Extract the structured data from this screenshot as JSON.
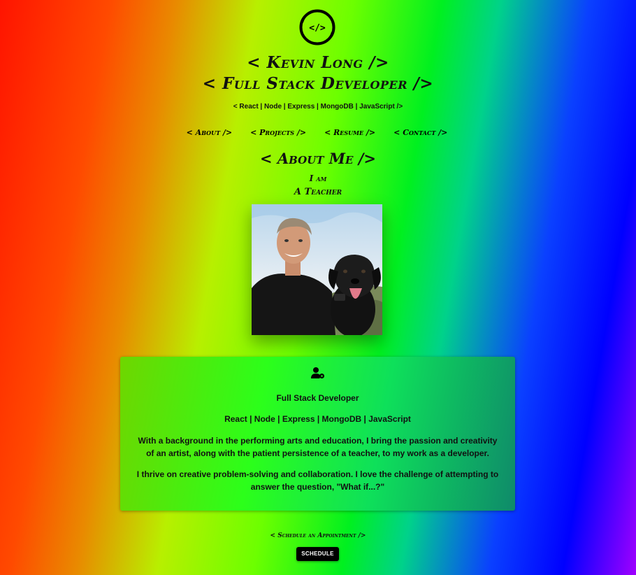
{
  "header": {
    "logo_text": "</>",
    "name": "< Kevin Long />",
    "role": "< Full Stack Developer />",
    "stack": "< React | Node | Express | MongoDB | JavaScript />"
  },
  "nav": {
    "about": "< About />",
    "projects": "< Projects />",
    "resume": "< Resume />",
    "contact": "< Contact />"
  },
  "about": {
    "title": "< About Me />",
    "i_am": "I am",
    "rotating_word": "A Teacher"
  },
  "card": {
    "icon": "user-gear-icon",
    "role": "Full Stack Developer",
    "stack": "React | Node | Express | MongoDB | JavaScript",
    "para1": "With a background in the performing arts and education, I bring the passion and creativity of an artist, along with the patient persistence of a teacher, to my work as a developer.",
    "para2": "I thrive on creative problem-solving and collaboration. I love the challenge of attempting to answer the question, \"What if...?\""
  },
  "footer": {
    "schedule_label": "< Schedule an Appointment />",
    "schedule_button": "SCHEDULE"
  }
}
